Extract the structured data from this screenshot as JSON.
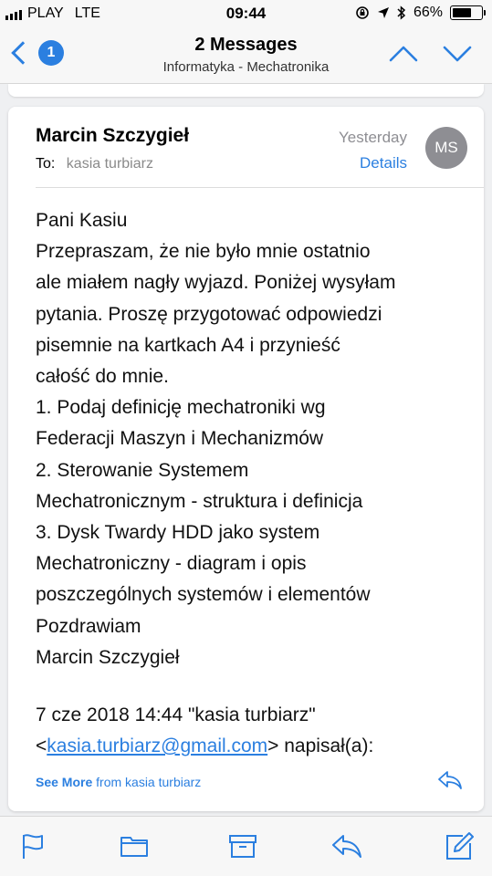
{
  "status_bar": {
    "carrier": "PLAY",
    "network": "LTE",
    "time": "09:44",
    "battery_percent": "66%",
    "battery_level": 0.66
  },
  "nav": {
    "back_count": "1",
    "title": "2 Messages",
    "subtitle": "Informatyka - Mechatronika"
  },
  "message": {
    "from": "Marcin Szczygieł",
    "to_label": "To:",
    "to": "kasia turbiarz",
    "date": "Yesterday",
    "details_label": "Details",
    "avatar_initials": "MS",
    "body_lines": [
      "Pani Kasiu",
      "Przepraszam, że nie było mnie ostatnio",
      "ale miałem nagły wyjazd. Poniżej wysyłam",
      "pytania. Proszę przygotować odpowiedzi",
      "pisemnie na kartkach A4 i przynieść",
      "całość do mnie.",
      "1. Podaj definicję mechatroniki wg",
      "Federacji Maszyn i Mechanizmów",
      "2. Sterowanie Systemem",
      "Mechatronicznym - struktura i definicja",
      "3. Dysk Twardy HDD jako system",
      "Mechatroniczny - diagram i opis",
      "poszczególnych systemów i elementów",
      "Pozdrawiam",
      "Marcin Szczygieł"
    ],
    "quote_line1": "7 cze 2018 14:44 \"kasia turbiarz\"",
    "quote_lt": "<",
    "quote_email": "kasia.turbiarz@gmail.com",
    "quote_tail": "> napisał(a):",
    "see_more_label": "See More",
    "see_more_from": "from kasia turbiarz"
  },
  "colors": {
    "accent": "#2b7fe0",
    "secondary_text": "#8e8e93",
    "background": "#eff0f2"
  },
  "toolbar": {
    "icons": [
      "flag-icon",
      "folder-icon",
      "archive-icon",
      "reply-icon",
      "compose-icon"
    ]
  }
}
